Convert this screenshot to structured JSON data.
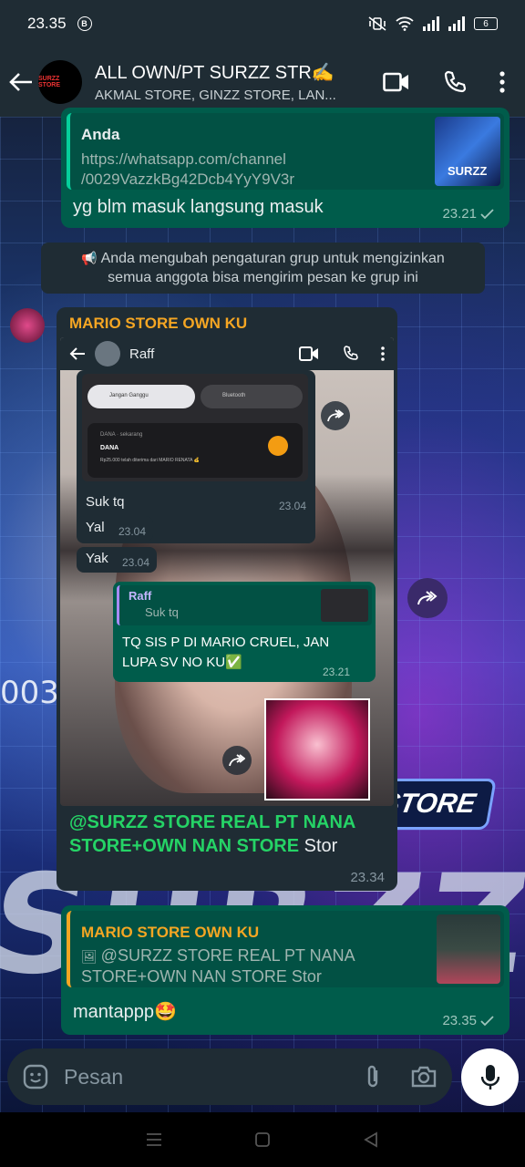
{
  "status_bar": {
    "time": "23.35",
    "badge": "B",
    "battery": "6"
  },
  "header": {
    "avatar_text": "SURZZ STORE",
    "title": "ALL OWN/PT SURZZ STR✍",
    "subtitle": "AKMAL STORE, GINZZ STORE, LAN..."
  },
  "messages": {
    "m1": {
      "quote_author": "Anda",
      "quote_text_line1": "https://whatsapp.com/channel",
      "quote_text_line2": "/0029VazzkBg42Dcb4YyY9V3r",
      "thumb_label": "SURZZ",
      "text": "yg blm masuk langsung masuk",
      "time": "23.21"
    },
    "system": {
      "line1": "Anda mengubah pengaturan grup untuk mengizinkan",
      "line2": "semua anggota bisa mengirim pesan ke grup ini"
    },
    "m2": {
      "sender": "MARIO STORE OWN KU",
      "text_highlight": "@SURZZ STORE REAL PT NANA STORE+OWN NAN STORE",
      "text_tail": " Stor",
      "time": "23.34",
      "inner": {
        "contact": "Raff",
        "dnd": "Jangan Ganggu",
        "bt": "Bluetooth",
        "notif_app": "DANA",
        "notif_meta": "DANA · sekarang",
        "notif_text": "Rp25.000 telah diterima dari MARIO RENATA 💰",
        "msg_suk": "Suk tq",
        "msg_suk_time": "23.04",
        "msg_yal": "Yal",
        "msg_yal_time": "23.04",
        "msg_yak": "Yak",
        "msg_yak_time": "23.04",
        "reply_author": "Raff",
        "reply_quote": "Suk tq",
        "reply_text": "TQ SIS P DI MARIO CRUEL, JAN LUPA SV NO KU✅",
        "reply_time": "23.21"
      }
    },
    "m3": {
      "quote_author": "MARIO STORE OWN KU",
      "quote_text": "@SURZZ STORE REAL PT NANA STORE+OWN NAN STORE Stor",
      "text": "mantappp🤩",
      "time": "23.35"
    }
  },
  "wallpaper": {
    "number": "0034",
    "big_text": "SURZZ",
    "badge_text": "STORE"
  },
  "input": {
    "placeholder": "Pesan"
  },
  "colors": {
    "header": "#1f2c34",
    "outgoing": "#005c4b",
    "incoming": "#1f2c34",
    "sender_name": "#f5a623",
    "accent_green": "#25d366"
  }
}
